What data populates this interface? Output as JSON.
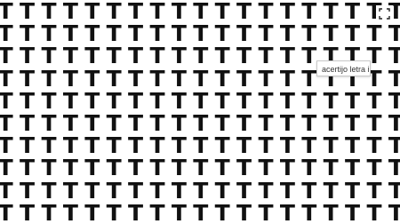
{
  "puzzle": {
    "glyph": "T",
    "rows": 10,
    "columns": 19
  },
  "image_label": "acertijo letra i",
  "icons": {
    "expand": "expand-icon"
  }
}
